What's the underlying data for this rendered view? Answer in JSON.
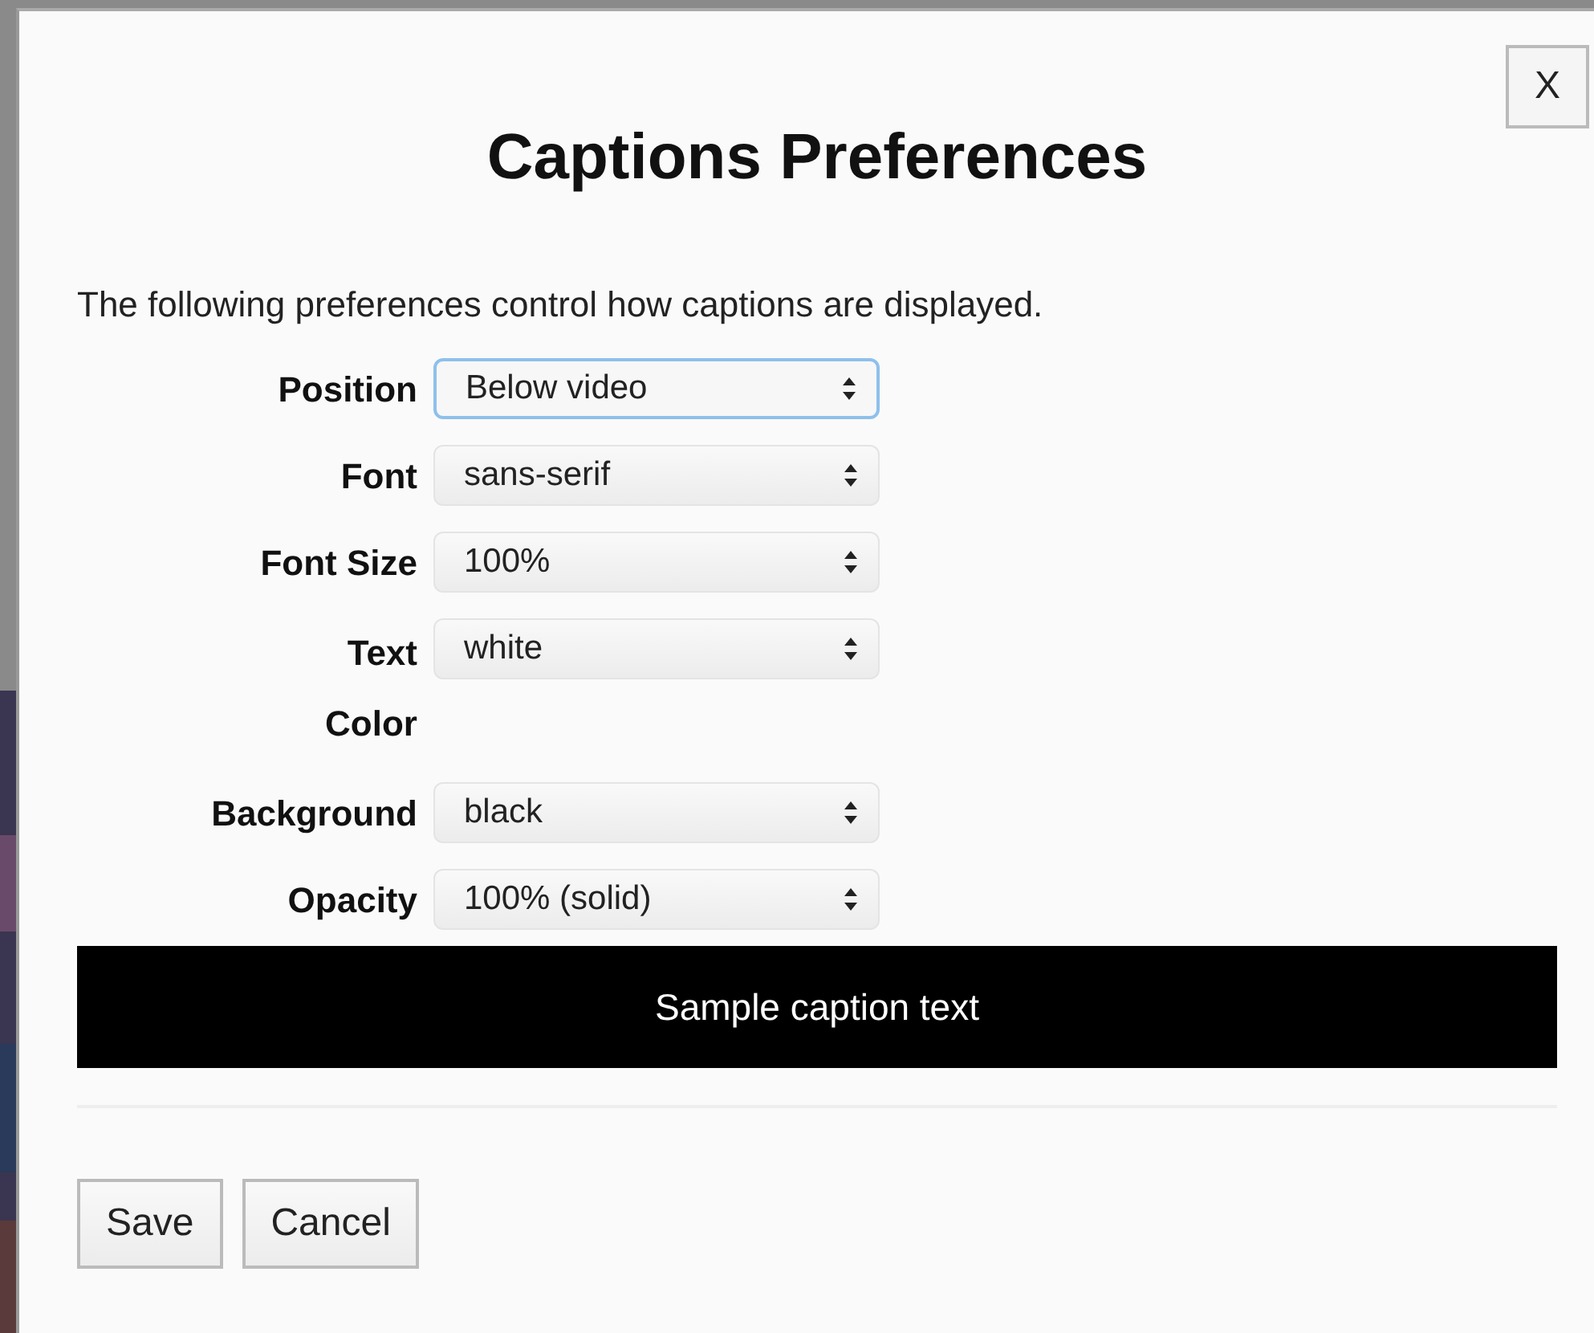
{
  "dialog": {
    "title": "Captions Preferences",
    "close_label": "X",
    "intro": "The following preferences control how captions are displayed.",
    "fields": [
      {
        "label": "Position",
        "value": "Below video",
        "focused": true
      },
      {
        "label": "Font",
        "value": "sans-serif",
        "focused": false
      },
      {
        "label": "Font Size",
        "value": "100%",
        "focused": false
      },
      {
        "label": "Text Color",
        "value": "white",
        "focused": false
      },
      {
        "label": "Background",
        "value": "black",
        "focused": false
      },
      {
        "label": "Opacity",
        "value": "100% (solid)",
        "focused": false
      }
    ],
    "sample": "Sample caption text",
    "buttons": [
      "Save",
      "Cancel"
    ]
  }
}
